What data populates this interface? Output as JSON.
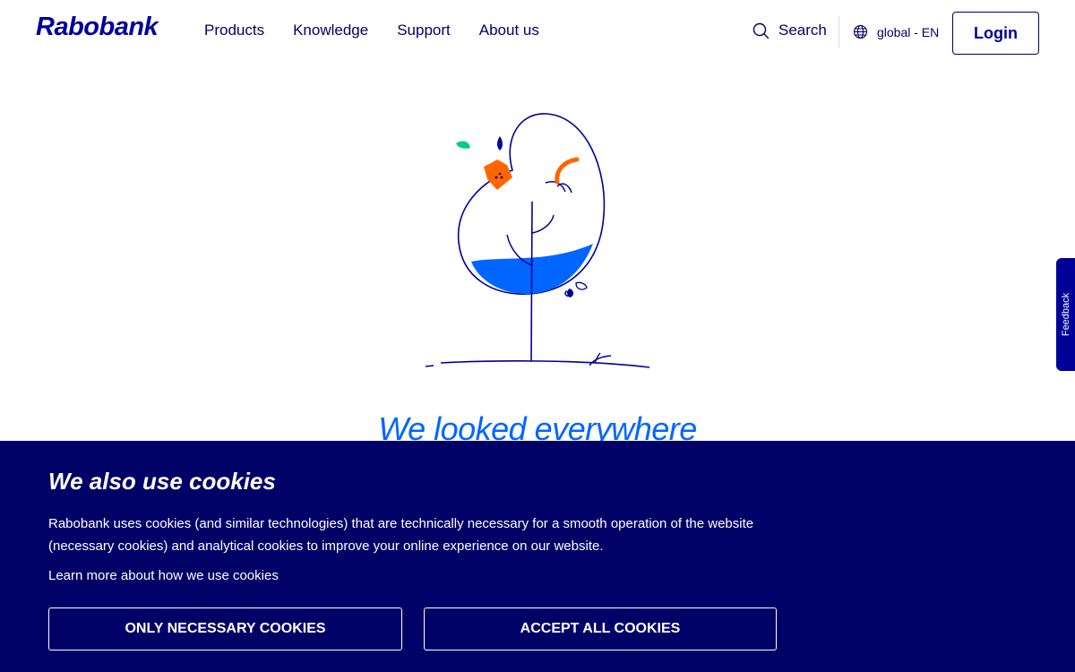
{
  "header": {
    "logo": "Rabobank",
    "nav": [
      "Products",
      "Knowledge",
      "Support",
      "About us"
    ],
    "search_label": "Search",
    "language_label": "global - EN",
    "login_label": "Login"
  },
  "main": {
    "headline": "We looked everywhere"
  },
  "feedback_tab": {
    "label": "Feedback"
  },
  "cookie_banner": {
    "title": "We also use cookies",
    "text": "Rabobank uses cookies (and similar technologies) that are technically necessary for a smooth operation of the website (necessary cookies) and analytical cookies to improve your online experience on our website.",
    "learn_more": "Learn more about how we use cookies",
    "necessary_button": "ONLY NECESSARY COOKIES",
    "accept_button": "ACCEPT ALL COOKIES"
  },
  "colors": {
    "brand_navy": "#000066",
    "brand_blue": "#000099",
    "accent_blue": "#0066ff",
    "accent_orange": "#ff6600",
    "accent_green": "#00cc88"
  },
  "icons": {
    "search": "search-icon",
    "language": "globe-icon"
  }
}
